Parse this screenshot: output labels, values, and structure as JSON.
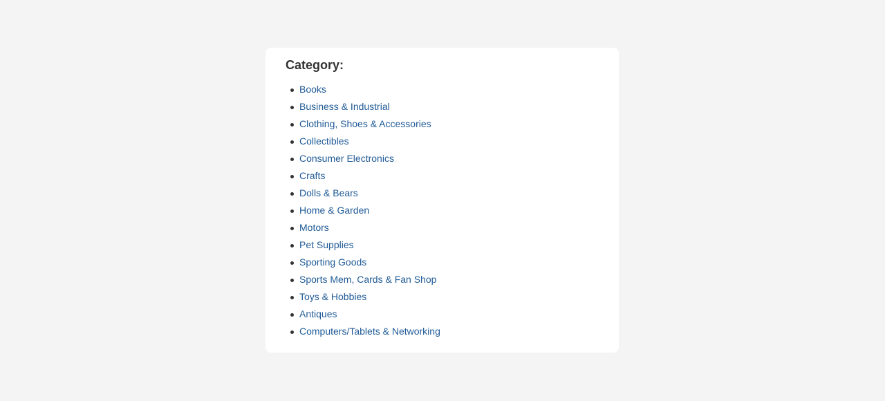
{
  "panel": {
    "title": "Category:"
  },
  "categories": [
    "Books",
    "Business & Industrial",
    "Clothing, Shoes & Accessories",
    "Collectibles",
    "Consumer Electronics",
    "Crafts",
    "Dolls & Bears",
    "Home & Garden",
    "Motors",
    "Pet Supplies",
    "Sporting Goods",
    "Sports Mem, Cards & Fan Shop",
    "Toys & Hobbies",
    "Antiques",
    "Computers/Tablets & Networking"
  ],
  "colors": {
    "link": "#1f5a96",
    "title": "#333333",
    "page_background": "#f4f4f4",
    "card_background": "#ffffff"
  }
}
